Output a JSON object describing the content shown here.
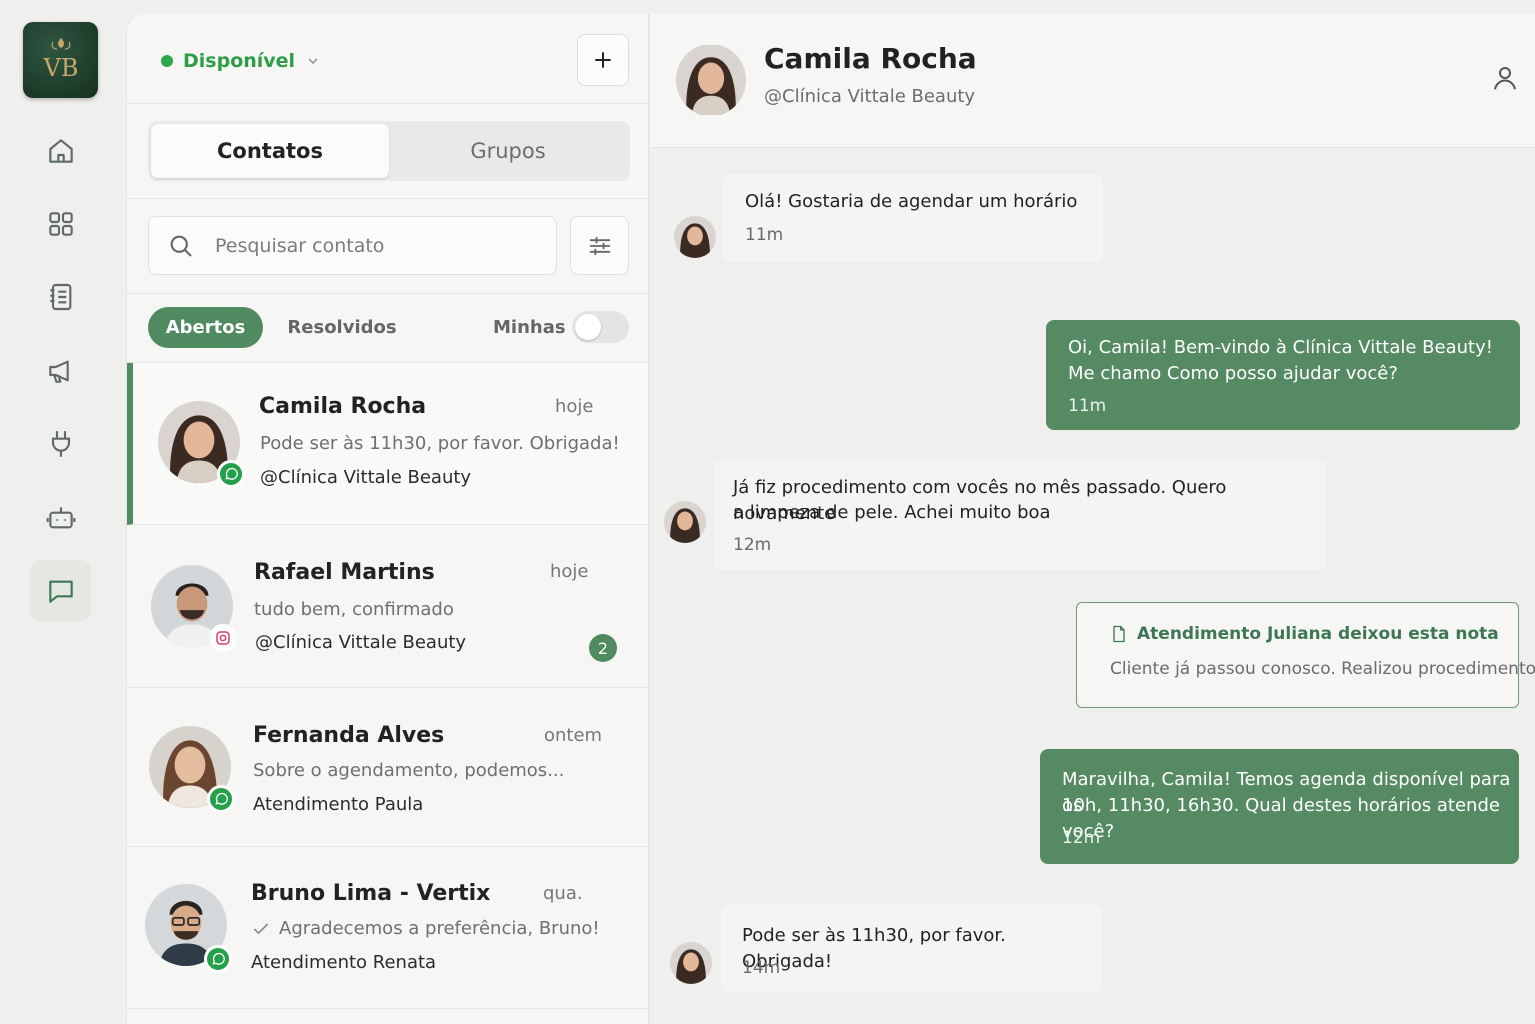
{
  "brand": {
    "logo_text": "VB"
  },
  "rail": {
    "items": [
      {
        "icon": "home-icon"
      },
      {
        "icon": "grid-icon"
      },
      {
        "icon": "notebook-icon"
      },
      {
        "icon": "megaphone-icon"
      },
      {
        "icon": "plug-icon"
      },
      {
        "icon": "robot-icon"
      },
      {
        "icon": "chat-icon",
        "active": true
      }
    ]
  },
  "status": {
    "label": "Disponível",
    "color": "#2fa84b"
  },
  "tabs": [
    {
      "label": "Contatos",
      "active": true
    },
    {
      "label": "Grupos",
      "active": false
    }
  ],
  "search": {
    "placeholder": "Pesquisar contato"
  },
  "filters": {
    "open_label": "Abertos",
    "resolved_label": "Resolvidos",
    "mine_label": "Minhas",
    "mine_enabled": false
  },
  "contacts": [
    {
      "name": "Camila Rocha",
      "time": "hoje",
      "message": "Pode ser às 11h30, por favor. Obrigada!",
      "subtitle": "@Clínica Vittale Beauty",
      "channel": "whatsapp",
      "active": true
    },
    {
      "name": "Rafael Martins",
      "time": "hoje",
      "message": "tudo bem, confirmado",
      "subtitle": "@Clínica Vittale Beauty",
      "channel": "instagram",
      "unread": "2"
    },
    {
      "name": "Fernanda Alves",
      "time": "ontem",
      "message": "Sobre o agendamento, podemos...",
      "subtitle": "Atendimento Paula",
      "channel": "whatsapp"
    },
    {
      "name": "Bruno Lima - Vertix",
      "time": "qua.",
      "message": "Agradecemos a preferência, Bruno!",
      "subtitle": "Atendimento Renata",
      "channel": "whatsapp",
      "read_check": true
    }
  ],
  "chat": {
    "name": "Camila Rocha",
    "subtitle": "@Clínica Vittale Beauty",
    "messages": [
      {
        "dir": "in",
        "lines": [
          "Olá! Gostaria de agendar um horário"
        ],
        "time": "11m"
      },
      {
        "dir": "out",
        "lines": [
          "Oi, Camila! Bem-vindo à Clínica Vittale Beauty!",
          "Me chamo Como posso ajudar você?"
        ],
        "time": "11m"
      },
      {
        "dir": "in",
        "lines": [
          "Já fiz procedimento com vocês no mês passado. Quero novamente",
          "a limpeza de pele. Achei muito boa"
        ],
        "time": "12m"
      },
      {
        "dir": "out",
        "lines": [
          "Maravilha, Camila! Temos agenda disponível para os",
          "10h, 11h30, 16h30. Qual destes horários atende você?"
        ],
        "time": "12m"
      },
      {
        "dir": "in",
        "lines": [
          "Pode ser às 11h30, por favor. Obrigada!"
        ],
        "time": "14m"
      }
    ],
    "note": {
      "title": "Atendimento Juliana deixou esta nota",
      "text": "Cliente já passou conosco. Realizou procedimento"
    }
  },
  "colors": {
    "accent": "#4f8a60",
    "outgoing_bubble": "#558a63",
    "whatsapp": "#25a04a"
  }
}
